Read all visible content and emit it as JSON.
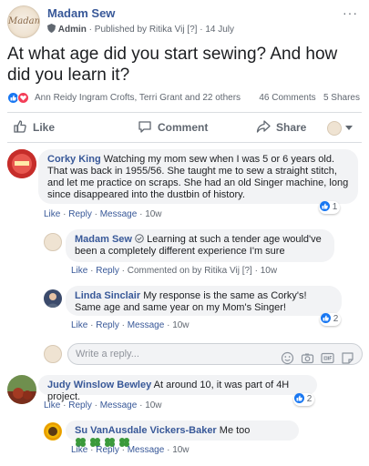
{
  "post": {
    "page_name": "Madam Sew",
    "avatar_text": "Madam Sew",
    "role": "Admin",
    "published_by": "· Published by Ritika Vij",
    "help_mark": "[?]",
    "date": "· 14 July",
    "more": "···",
    "title": "At what age did you start sewing? And how did you learn it?",
    "reacted_by": "Ann Reidy Ingram Crofts, Terri Grant and 22 others",
    "comments_count": "46 Comments",
    "shares_count": "5 Shares",
    "reaction_icons": [
      "like-icon",
      "heart-icon"
    ]
  },
  "actions": {
    "like": "Like",
    "comment": "Comment",
    "share": "Share"
  },
  "comments": [
    {
      "author": "Corky King",
      "text": "Watching my mom sew when I was 5 or 6 years old. That was back in 1955/56. She taught me to sew a straight stitch, and let me practice on scraps. She had an old Singer machine, long since disappeared into the dustbin of history.",
      "like": "Like",
      "reply": "Reply",
      "message": "Message",
      "time": "10w",
      "reactions": "1"
    },
    {
      "author": "Madam Sew",
      "text": "Learning at such a tender age would've been a completely different experience I'm sure",
      "like": "Like",
      "reply": "Reply",
      "commented_on_by": "Commented on by Ritika Vij",
      "help_mark": "[?]",
      "time": "10w"
    },
    {
      "author": "Linda Sinclair",
      "text": "My response is the same as Corky's! Same age and same year on my Mom's Singer!",
      "like": "Like",
      "reply": "Reply",
      "message": "Message",
      "time": "10w",
      "reactions": "2"
    },
    {
      "author": "Judy Winslow Bewley",
      "text": "At around 10, it was part of 4H project.",
      "like": "Like",
      "reply": "Reply",
      "message": "Message",
      "time": "10w",
      "reactions": "2"
    },
    {
      "author": "Su VanAusdale Vickers-Baker",
      "text": "Me too",
      "like": "Like",
      "reply": "Reply",
      "message": "Message",
      "time": "10w"
    }
  ],
  "reply_box": {
    "placeholder": "Write a reply...",
    "icons": [
      "emoji-icon",
      "camera-icon",
      "gif-icon",
      "sticker-icon"
    ]
  },
  "colors": {
    "link_blue": "#385898",
    "like_blue": "#1877f2",
    "love_red": "#f33e58",
    "bubble_gray": "#f2f3f5",
    "clover_green": "#3b9a3b"
  }
}
